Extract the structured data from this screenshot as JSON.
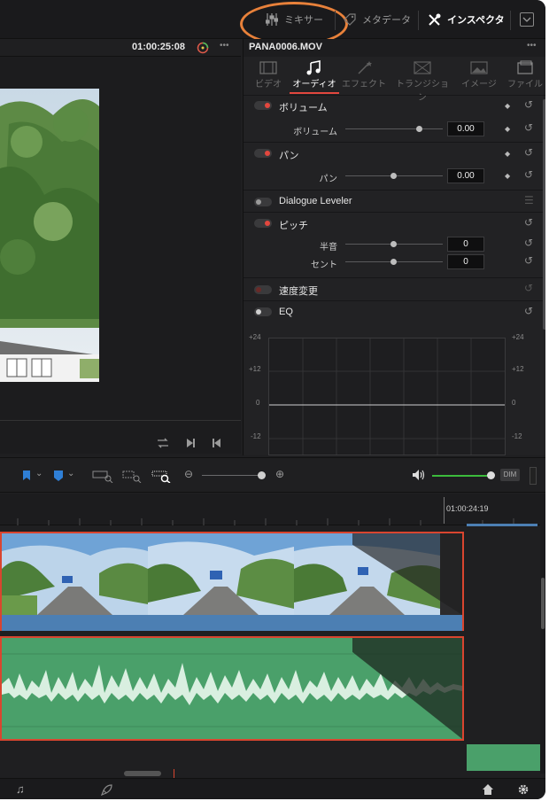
{
  "topbar": {
    "mixer_label": "ミキサー",
    "metadata_label": "メタデータ",
    "inspector_label": "インスペクタ",
    "mixer_icon": "sliders-icon",
    "metadata_icon": "tag-icon",
    "inspector_icon": "tools-icon",
    "expand_icon": "chevron-down-icon",
    "highlight_color": "#e8813a"
  },
  "viewer": {
    "timecode": "01:00:25:08",
    "more": "•••"
  },
  "inspector": {
    "clip_name": "PANA0006.MOV",
    "more": "•••",
    "tabs": [
      {
        "label": "ビデオ",
        "icon": "film-icon"
      },
      {
        "label": "オーディオ",
        "icon": "music-note-icon"
      },
      {
        "label": "エフェクト",
        "icon": "magic-wand-icon"
      },
      {
        "label": "トランジション",
        "icon": "transition-icon"
      },
      {
        "label": "イメージ",
        "icon": "image-icon"
      },
      {
        "label": "ファイル",
        "icon": "file-icon"
      }
    ],
    "active_tab": "オーディオ",
    "accent_color": "#e2473e",
    "volume": {
      "title": "ボリューム",
      "param_label": "ボリューム",
      "value": "0.00"
    },
    "pan": {
      "title": "パン",
      "param_label": "パン",
      "value": "0.00"
    },
    "dialogue": {
      "title": "Dialogue Leveler"
    },
    "pitch": {
      "title": "ピッチ",
      "semitone_label": "半音",
      "semitone_value": "0",
      "cent_label": "セント",
      "cent_value": "0"
    },
    "speed": {
      "title": "速度変更"
    },
    "eq": {
      "title": "EQ",
      "y_labels": [
        "+24",
        "+12",
        "0",
        "-12"
      ]
    }
  },
  "timeline": {
    "timecode": "01:00:24:19",
    "dim_label": "DIM",
    "track_colors": {
      "video": "#4c7fb3",
      "audio": "#4aa06a",
      "selected": "#d9452f"
    }
  }
}
